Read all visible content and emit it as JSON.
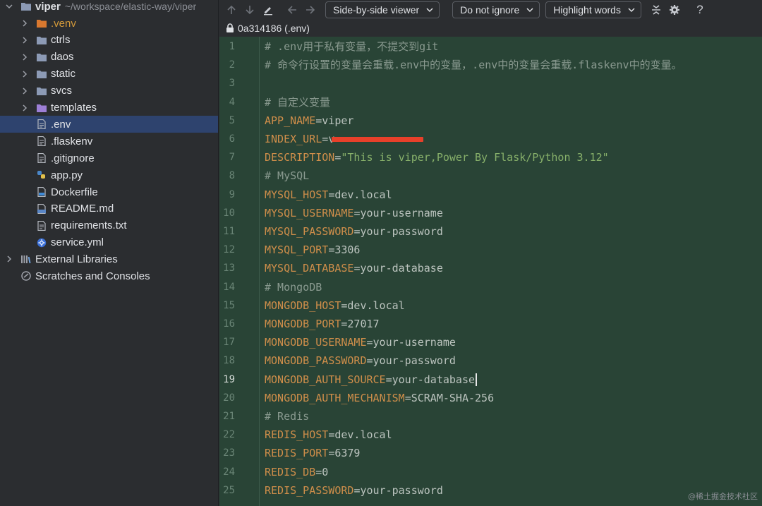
{
  "sidebar": {
    "root": {
      "name": "viper",
      "path": "~/workspace/elastic-way/viper"
    },
    "items": [
      {
        "label": ".venv",
        "type": "folder-excluded",
        "expandable": true
      },
      {
        "label": "ctrls",
        "type": "folder",
        "expandable": true
      },
      {
        "label": "daos",
        "type": "folder",
        "expandable": true
      },
      {
        "label": "static",
        "type": "folder",
        "expandable": true
      },
      {
        "label": "svcs",
        "type": "folder",
        "expandable": true
      },
      {
        "label": "templates",
        "type": "folder-templates",
        "expandable": true
      },
      {
        "label": ".env",
        "type": "file",
        "selected": true
      },
      {
        "label": ".flaskenv",
        "type": "file"
      },
      {
        "label": ".gitignore",
        "type": "file"
      },
      {
        "label": "app.py",
        "type": "python"
      },
      {
        "label": "Dockerfile",
        "type": "docker"
      },
      {
        "label": "README.md",
        "type": "markdown"
      },
      {
        "label": "requirements.txt",
        "type": "file"
      },
      {
        "label": "service.yml",
        "type": "kubernetes"
      }
    ],
    "external_libraries": "External Libraries",
    "scratches": "Scratches and Consoles"
  },
  "toolbar": {
    "viewer_label": "Side-by-side viewer",
    "ignore_label": "Do not ignore",
    "highlight_label": "Highlight words",
    "help_label": "?"
  },
  "file_header": {
    "title": "0a314186 (.env)"
  },
  "editor": {
    "current_line": 19,
    "lines": [
      {
        "n": "1",
        "parts": [
          {
            "t": "# .env用于私有变量，不提交到git",
            "c": "comment"
          }
        ]
      },
      {
        "n": "2",
        "parts": [
          {
            "t": "# 命令行设置的变量会重载.env中的变量，.env中的变量会重载.flaskenv中的变量。",
            "c": "comment"
          }
        ]
      },
      {
        "n": "3",
        "parts": []
      },
      {
        "n": "4",
        "parts": [
          {
            "t": "# 自定义变量",
            "c": "comment"
          }
        ]
      },
      {
        "n": "5",
        "parts": [
          {
            "t": "APP_NAME",
            "c": "key"
          },
          {
            "t": "=",
            "c": "eq"
          },
          {
            "t": "viper",
            "c": "val"
          }
        ]
      },
      {
        "n": "6",
        "parts": [
          {
            "t": "INDEX_URL",
            "c": "key"
          },
          {
            "t": "=",
            "c": "eq"
          },
          {
            "t": "v",
            "c": "val"
          }
        ],
        "redacted": true
      },
      {
        "n": "7",
        "parts": [
          {
            "t": "DESCRIPTION",
            "c": "key"
          },
          {
            "t": "=",
            "c": "eq"
          },
          {
            "t": "\"This is viper,Power By Flask/Python 3.12\"",
            "c": "str"
          }
        ]
      },
      {
        "n": "8",
        "parts": [
          {
            "t": "# MySQL",
            "c": "comment"
          }
        ]
      },
      {
        "n": "9",
        "parts": [
          {
            "t": "MYSQL_HOST",
            "c": "key"
          },
          {
            "t": "=",
            "c": "eq"
          },
          {
            "t": "dev.local",
            "c": "val"
          }
        ]
      },
      {
        "n": "10",
        "parts": [
          {
            "t": "MYSQL_USERNAME",
            "c": "key"
          },
          {
            "t": "=",
            "c": "eq"
          },
          {
            "t": "your-username",
            "c": "val"
          }
        ]
      },
      {
        "n": "11",
        "parts": [
          {
            "t": "MYSQL_PASSWORD",
            "c": "key"
          },
          {
            "t": "=",
            "c": "eq"
          },
          {
            "t": "your-password",
            "c": "val"
          }
        ]
      },
      {
        "n": "12",
        "parts": [
          {
            "t": "MYSQL_PORT",
            "c": "key"
          },
          {
            "t": "=",
            "c": "eq"
          },
          {
            "t": "3306",
            "c": "val"
          }
        ]
      },
      {
        "n": "13",
        "parts": [
          {
            "t": "MYSQL_DATABASE",
            "c": "key"
          },
          {
            "t": "=",
            "c": "eq"
          },
          {
            "t": "your-database",
            "c": "val"
          }
        ]
      },
      {
        "n": "14",
        "parts": [
          {
            "t": "# MongoDB",
            "c": "comment"
          }
        ]
      },
      {
        "n": "15",
        "parts": [
          {
            "t": "MONGODB_HOST",
            "c": "key"
          },
          {
            "t": "=",
            "c": "eq"
          },
          {
            "t": "dev.local",
            "c": "val"
          }
        ]
      },
      {
        "n": "16",
        "parts": [
          {
            "t": "MONGODB_PORT",
            "c": "key"
          },
          {
            "t": "=",
            "c": "eq"
          },
          {
            "t": "27017",
            "c": "val"
          }
        ]
      },
      {
        "n": "17",
        "parts": [
          {
            "t": "MONGODB_USERNAME",
            "c": "key"
          },
          {
            "t": "=",
            "c": "eq"
          },
          {
            "t": "your-username",
            "c": "val"
          }
        ]
      },
      {
        "n": "18",
        "parts": [
          {
            "t": "MONGODB_PASSWORD",
            "c": "key"
          },
          {
            "t": "=",
            "c": "eq"
          },
          {
            "t": "your-password",
            "c": "val"
          }
        ]
      },
      {
        "n": "19",
        "parts": [
          {
            "t": "MONGODB_AUTH_SOURCE",
            "c": "key"
          },
          {
            "t": "=",
            "c": "eq"
          },
          {
            "t": "your-database",
            "c": "val"
          }
        ],
        "caret": true
      },
      {
        "n": "20",
        "parts": [
          {
            "t": "MONGODB_AUTH_MECHANISM",
            "c": "key"
          },
          {
            "t": "=",
            "c": "eq"
          },
          {
            "t": "SCRAM-SHA-256",
            "c": "val"
          }
        ]
      },
      {
        "n": "21",
        "parts": [
          {
            "t": "# Redis",
            "c": "comment"
          }
        ]
      },
      {
        "n": "22",
        "parts": [
          {
            "t": "REDIS_HOST",
            "c": "key"
          },
          {
            "t": "=",
            "c": "eq"
          },
          {
            "t": "dev.local",
            "c": "val"
          }
        ]
      },
      {
        "n": "23",
        "parts": [
          {
            "t": "REDIS_PORT",
            "c": "key"
          },
          {
            "t": "=",
            "c": "eq"
          },
          {
            "t": "6379",
            "c": "val"
          }
        ]
      },
      {
        "n": "24",
        "parts": [
          {
            "t": "REDIS_DB",
            "c": "key"
          },
          {
            "t": "=",
            "c": "eq"
          },
          {
            "t": "0",
            "c": "val"
          }
        ]
      },
      {
        "n": "25",
        "parts": [
          {
            "t": "REDIS_PASSWORD",
            "c": "key"
          },
          {
            "t": "=",
            "c": "eq"
          },
          {
            "t": "your-password",
            "c": "val"
          }
        ]
      }
    ]
  },
  "watermark": "@稀土掘金技术社区",
  "colors": {
    "editor_bg": "#294436",
    "key": "#cf8e4a",
    "string": "#87b06a",
    "redaction": "#e8402a",
    "selection": "#2e436e"
  }
}
